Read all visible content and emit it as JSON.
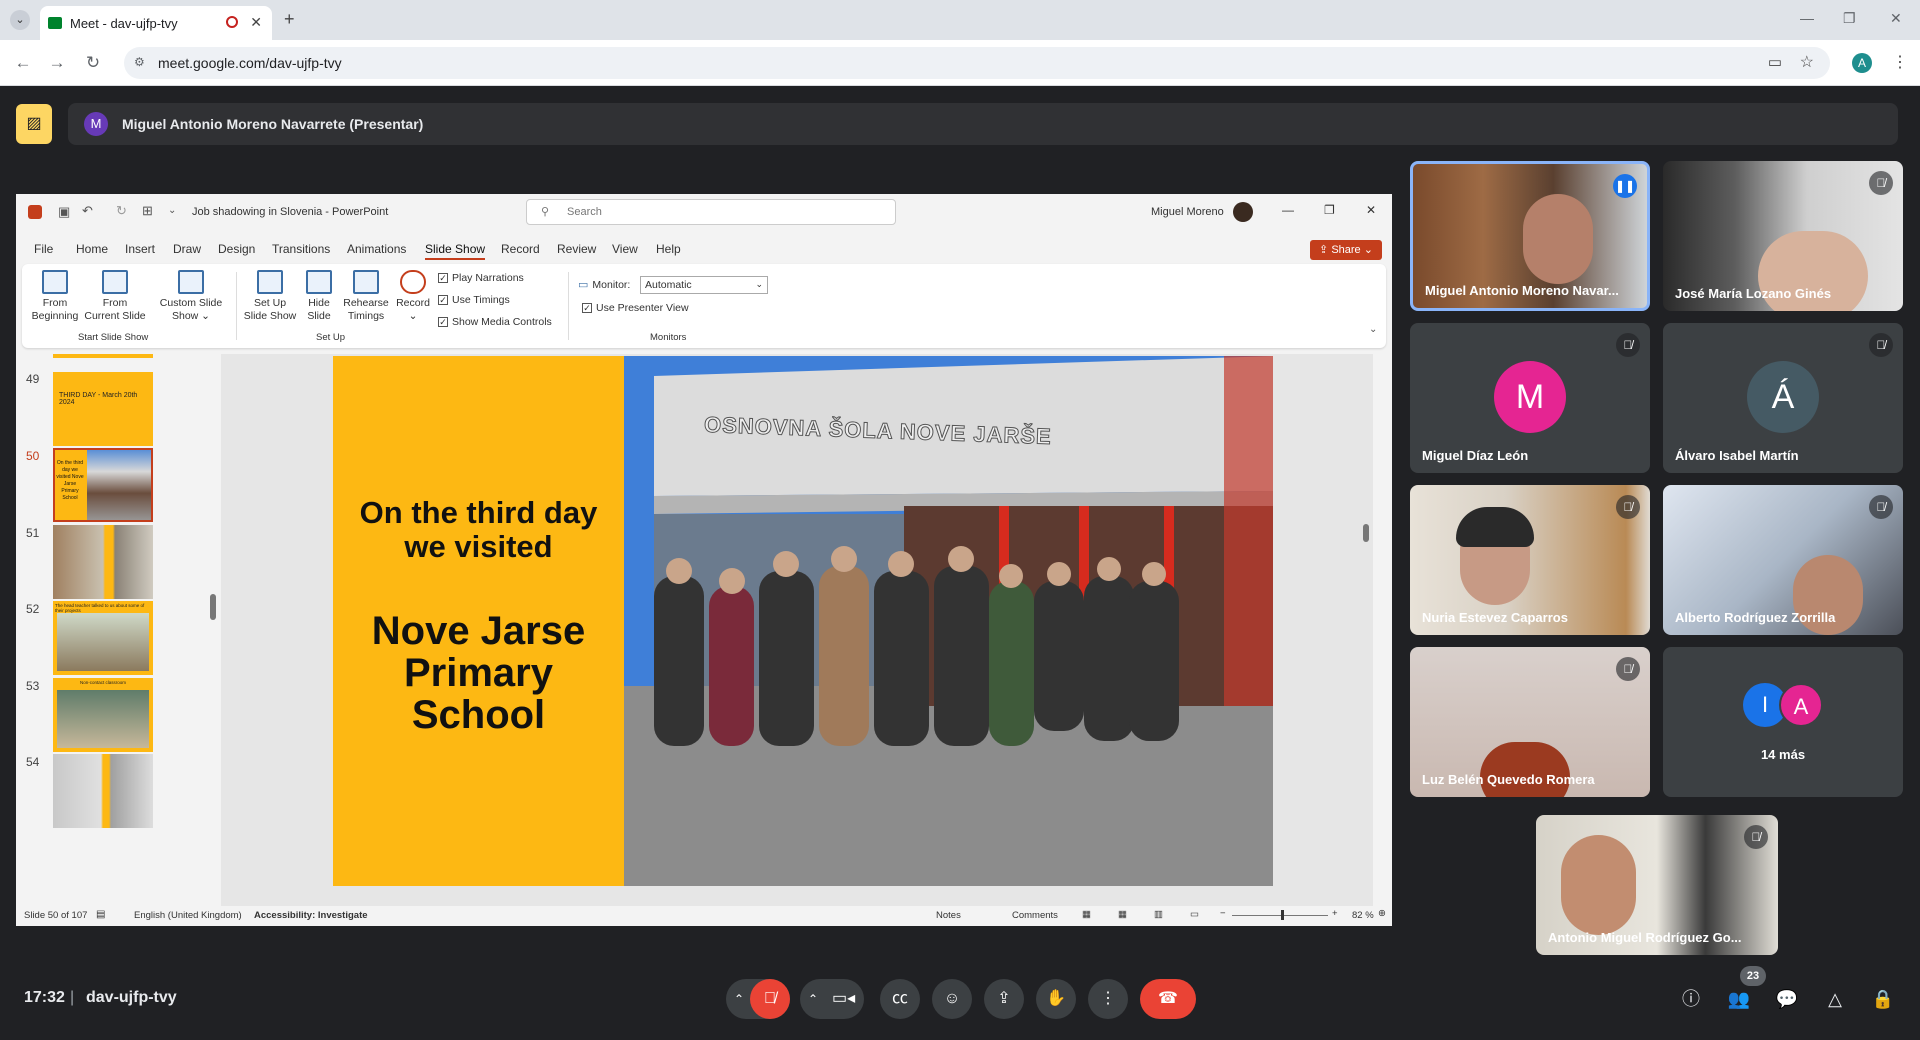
{
  "browser": {
    "tab_title": "Meet - dav-ujfp-tvy",
    "url": "meet.google.com/dav-ujfp-tvy",
    "profile_initial": "A"
  },
  "meet": {
    "presenter_initial": "M",
    "presenter_label": "Miguel Antonio Moreno Navarrete (Presentar)",
    "time": "17:32",
    "separator": "|",
    "meeting_code": "dav-ujfp-tvy",
    "participants_count": "23",
    "tiles": [
      {
        "name": "Miguel Antonio Moreno Navar..."
      },
      {
        "name": "José María Lozano Ginés"
      },
      {
        "name": "Miguel Díaz León",
        "initial": "M"
      },
      {
        "name": "Álvaro Isabel Martín",
        "initial": "Á"
      },
      {
        "name": "Nuria Estevez Caparros"
      },
      {
        "name": "Alberto Rodríguez Zorrilla"
      },
      {
        "name": "Luz Belén Quevedo Romera"
      },
      {
        "more_label": "14 más",
        "initials": [
          "I",
          "A"
        ]
      },
      {
        "name": "Antonio Miguel Rodríguez Go..."
      }
    ]
  },
  "ppt": {
    "doc_title": "Job shadowing in Slovenia  -  PowerPoint",
    "search_placeholder": "Search",
    "user": "Miguel Moreno",
    "share": "Share",
    "tabs": [
      "File",
      "Home",
      "Insert",
      "Draw",
      "Design",
      "Transitions",
      "Animations",
      "Slide Show",
      "Record",
      "Review",
      "View",
      "Help"
    ],
    "ribbon": {
      "from_beginning": [
        "From",
        "Beginning"
      ],
      "from_current": [
        "From",
        "Current Slide"
      ],
      "custom": [
        "Custom Slide",
        "Show ⌄"
      ],
      "setup": [
        "Set Up",
        "Slide Show"
      ],
      "hide": [
        "Hide",
        "Slide"
      ],
      "rehearse": [
        "Rehearse",
        "Timings"
      ],
      "record": [
        "Record",
        "⌄"
      ],
      "play_narrations": "Play Narrations",
      "use_timings": "Use Timings",
      "show_media": "Show Media Controls",
      "monitor_label": "Monitor:",
      "monitor_value": "Automatic",
      "presenter_view": "Use Presenter View",
      "group_start": "Start Slide Show",
      "group_setup": "Set Up",
      "group_monitors": "Monitors"
    },
    "thumbs": [
      {
        "num": "49",
        "text": "THIRD DAY - March 20th 2024"
      },
      {
        "num": "50",
        "text": "On the third day we visited Nove Jarse Primary School"
      },
      {
        "num": "51",
        "text": ""
      },
      {
        "num": "52",
        "text": "The head teacher talked to us about some of their projects"
      },
      {
        "num": "53",
        "text": "Non-contact classroom"
      },
      {
        "num": "54",
        "text": ""
      }
    ],
    "slide": {
      "line1": "On the third day",
      "line2": "we visited",
      "line3": "Nove Jarse",
      "line4": "Primary",
      "line5": "School",
      "sign": "OSNOVNA ŠOLA NOVE JARŠE"
    },
    "status": {
      "slide": "Slide 50 of 107",
      "lang": "English (United Kingdom)",
      "access": "Accessibility: Investigate",
      "notes": "Notes",
      "comments": "Comments",
      "zoom": "82 %"
    }
  }
}
